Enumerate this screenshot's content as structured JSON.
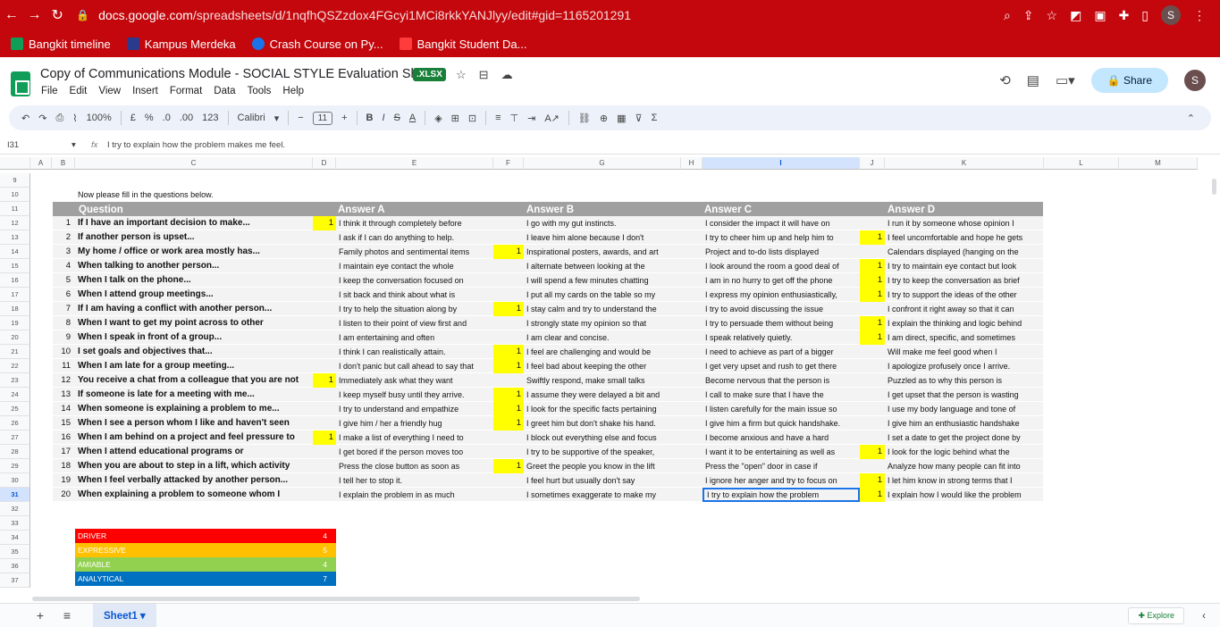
{
  "browser": {
    "url_host": "docs.google.com",
    "url_path": "/spreadsheets/d/1nqfhQSZzdox4FGcyi1MCi8rkkYANJlyy/edit#gid=1165201291",
    "bookmarks": [
      "Bangkit timeline",
      "Kampus Merdeka",
      "Crash Course on Py...",
      "Bangkit Student Da..."
    ],
    "profile_initial": "S"
  },
  "app": {
    "title": "Copy of Communications Module - SOCIAL STYLE Evaluation Sheet",
    "badge": ".XLSX",
    "menu": [
      "File",
      "Edit",
      "View",
      "Insert",
      "Format",
      "Data",
      "Tools",
      "Help"
    ],
    "share_label": "Share",
    "avatar_initial": "S"
  },
  "toolbar": {
    "zoom": "100%",
    "currency": "£",
    "percent": "%",
    "dec_less": ".0",
    "dec_more": ".00",
    "number_format": "123",
    "font": "Calibri",
    "font_size": "11"
  },
  "formula_bar": {
    "cell_ref": "I31",
    "fx": "fx",
    "content": "I try to explain how the problem makes me feel."
  },
  "columns": [
    "A",
    "B",
    "C",
    "D",
    "E",
    "F",
    "G",
    "H",
    "I",
    "J",
    "K",
    "L",
    "M"
  ],
  "rows": [
    "9",
    "10",
    "11",
    "12",
    "13",
    "14",
    "15",
    "16",
    "17",
    "18",
    "19",
    "20",
    "21",
    "22",
    "23",
    "24",
    "25",
    "26",
    "27",
    "28",
    "29",
    "30",
    "31",
    "32",
    "33",
    "34",
    "35",
    "36",
    "37"
  ],
  "intro": "Now please fill in the questions below.",
  "headers": {
    "question": "Question",
    "a": "Answer A",
    "b": "Answer B",
    "c": "Answer C",
    "d": "Answer D"
  },
  "questions": [
    {
      "n": "1",
      "q": "If I have an important decision to make...",
      "a": "I think it through completely before",
      "b": "I go with my gut instincts.",
      "c": "I consider the impact it will have on",
      "d": "I run it by someone whose opinion I",
      "mark": "A"
    },
    {
      "n": "2",
      "q": "If another person is upset...",
      "a": "I ask if I can do anything to help.",
      "b": "I leave him alone because I don't",
      "c": "I try to cheer him up and help him to",
      "d": "I feel uncomfortable and hope he gets",
      "mark": "D"
    },
    {
      "n": "3",
      "q": "My home / office or work area mostly has...",
      "a": "Family photos and sentimental items",
      "b": "Inspirational posters, awards, and art",
      "c": "Project and to-do lists displayed",
      "d": "Calendars displayed (hanging on the",
      "mark": "B"
    },
    {
      "n": "4",
      "q": "When talking to another person...",
      "a": "I maintain eye contact the whole",
      "b": "I alternate between looking at the",
      "c": "I look around the room a good deal of",
      "d": "I try to maintain eye contact but look",
      "mark": "D"
    },
    {
      "n": "5",
      "q": "When I talk on the phone...",
      "a": "I keep the conversation focused on",
      "b": "I will spend a few minutes chatting",
      "c": "I am in no hurry to get off the phone",
      "d": "I try to keep the conversation as brief",
      "mark": "D"
    },
    {
      "n": "6",
      "q": "When I attend group meetings...",
      "a": "I sit back and think about what is",
      "b": "I put all my cards on the table so my",
      "c": "I express my opinion enthusiastically,",
      "d": "I try to support the ideas of the other",
      "mark": "D"
    },
    {
      "n": "7",
      "q": "If I am having a conflict with another person...",
      "a": "I try to help the situation along by",
      "b": "I stay calm and try to understand the",
      "c": "I try to avoid discussing the issue",
      "d": "I confront it right away so that it can",
      "mark": "B"
    },
    {
      "n": "8",
      "q": "When I want to get my point across to other",
      "a": "I listen to their point of view first and",
      "b": "I strongly state my opinion so that",
      "c": "I try to persuade them without being",
      "d": "I explain the thinking and logic behind",
      "mark": "D"
    },
    {
      "n": "9",
      "q": "When I speak in front of a group...",
      "a": "I am entertaining and often",
      "b": "I am clear and concise.",
      "c": "I speak relatively quietly.",
      "d": "I am direct, specific, and sometimes",
      "mark": "D"
    },
    {
      "n": "10",
      "q": "I set goals and objectives that...",
      "a": "I think I can realistically attain.",
      "b": "I feel are challenging and would be",
      "c": "I need to achieve as part of a bigger",
      "d": "Will make me feel good when I",
      "mark": "B"
    },
    {
      "n": "11",
      "q": "When I am late for a group meeting...",
      "a": "I don't panic but call ahead to say that",
      "b": "I feel bad about keeping the other",
      "c": "I get very upset and rush to get there",
      "d": "I apologize profusely once I arrive.",
      "mark": "B"
    },
    {
      "n": "12",
      "q": "You receive a chat from a colleague that you are not",
      "a": "Immediately ask what they want",
      "b": "Swiftly respond, make small talks",
      "c": "Become nervous that the person is",
      "d": "Puzzled as to why this person is",
      "mark": "A"
    },
    {
      "n": "13",
      "q": "If someone is late for a meeting with me...",
      "a": "I keep myself busy until they arrive.",
      "b": "I assume they were delayed a bit and",
      "c": "I call to make sure that I have the",
      "d": "I get upset that the person is wasting",
      "mark": "B"
    },
    {
      "n": "14",
      "q": "When someone is explaining a problem to me...",
      "a": "I try to understand and empathize",
      "b": "I look for the specific facts pertaining",
      "c": "I listen carefully for the main issue so",
      "d": "I use my body language and tone of",
      "mark": "B"
    },
    {
      "n": "15",
      "q": "When I see a person whom I like and haven't seen",
      "a": "I give him / her a friendly hug",
      "b": "I greet him but don't shake his hand.",
      "c": "I give him a firm but quick handshake.",
      "d": "I give him an enthusiastic handshake",
      "mark": "B"
    },
    {
      "n": "16",
      "q": "When I am behind on a project and feel pressure to",
      "a": "I make a list of everything I need to",
      "b": "I block out everything else and focus",
      "c": "I become anxious and have a hard",
      "d": "I set a date to get the project done by",
      "mark": "A"
    },
    {
      "n": "17",
      "q": "When I attend educational programs or",
      "a": "I get bored if the person moves too",
      "b": "I try to be supportive of the speaker,",
      "c": "I want it to be entertaining as well as",
      "d": "I look for the logic behind what the",
      "mark": "D"
    },
    {
      "n": "18",
      "q": "When you are about to step in a lift, which activity",
      "a": "Press the close button as soon as",
      "b": "Greet the people you know in the lift",
      "c": "Press the \"open\" door in case if",
      "d": "Analyze how many people can fit into",
      "mark": "B"
    },
    {
      "n": "19",
      "q": " When I feel verbally attacked by another person...",
      "a": "I tell her to stop it.",
      "b": "I feel hurt but usually don't say",
      "c": "I ignore her anger and try to focus on",
      "d": "I let him know in strong terms that I",
      "mark": "D"
    },
    {
      "n": "20",
      "q": "When explaining a problem to someone whom I",
      "a": "I explain the problem in as much",
      "b": "I sometimes exaggerate to make my",
      "c": "I try to explain how the problem",
      "d": "I explain how I would like the problem",
      "mark": "D"
    }
  ],
  "mark_value": "1",
  "styles": [
    {
      "label": "DRIVER",
      "value": "4",
      "color": "#ff0000"
    },
    {
      "label": "EXPRESSIVE",
      "value": "5",
      "color": "#ffc000"
    },
    {
      "label": "AMIABLE",
      "value": "4",
      "color": "#92d050"
    },
    {
      "label": "ANALYTICAL",
      "value": "7",
      "color": "#0070c0"
    }
  ],
  "sheet_tab": "Sheet1",
  "explore_label": "Explore"
}
